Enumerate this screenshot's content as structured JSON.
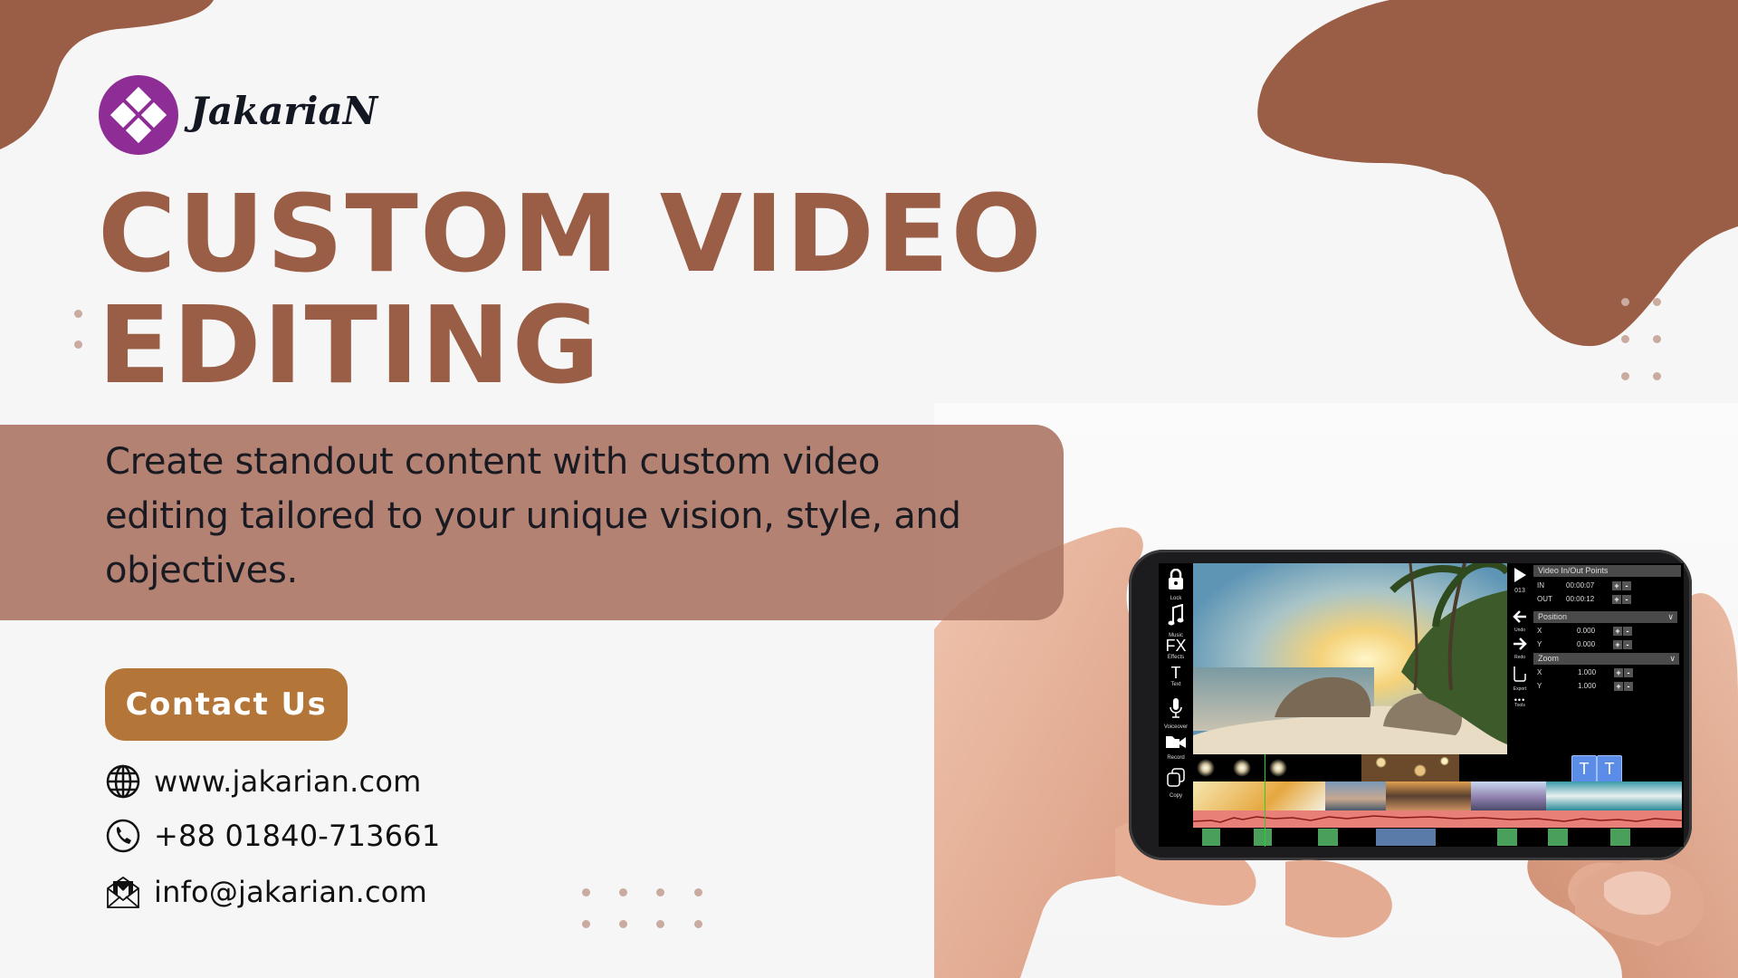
{
  "brand": {
    "name": "JakariaN",
    "logo_color": "#8e2d96"
  },
  "headline": {
    "line1": "CUSTOM VIDEO",
    "line2": "EDITING",
    "color": "#9a5d45"
  },
  "description": "Create standout content with custom video editing tailored to your unique vision, style, and objectives.",
  "cta": {
    "label": "Contact Us",
    "color": "#b47638"
  },
  "contacts": [
    {
      "icon": "globe-icon",
      "text": "www.jakarian.com"
    },
    {
      "icon": "phone-icon",
      "text": "+88 01840-713661"
    },
    {
      "icon": "mail-icon",
      "text": "info@jakarian.com"
    }
  ],
  "colors": {
    "accent_brown": "#9a5d45",
    "band": "#ac7665",
    "background": "#f6f6f6",
    "dots": "#c9aba0"
  },
  "phone_app": {
    "toolbar": [
      {
        "icon": "lock-icon",
        "label": "Lock"
      },
      {
        "icon": "music-icon",
        "label": "Music"
      },
      {
        "icon": "fx-icon",
        "glyph": "FX",
        "label": "Effects"
      },
      {
        "icon": "text-icon",
        "glyph": "T",
        "label": "Text"
      },
      {
        "icon": "microphone-icon",
        "label": "Voiceover"
      },
      {
        "icon": "video-camera-icon",
        "label": "Record"
      },
      {
        "icon": "copy-icon",
        "label": "Copy"
      }
    ],
    "side_actions": [
      {
        "icon": "play-icon",
        "label": "013"
      },
      {
        "icon": "undo-arrow-icon",
        "label": "Undo"
      },
      {
        "icon": "redo-arrow-icon",
        "label": "Redo"
      },
      {
        "icon": "export-icon",
        "label": "Export"
      },
      {
        "icon": "more-dots-icon",
        "label": "Tools"
      }
    ],
    "panel": {
      "inout_title": "Video In/Out Points",
      "in_label": "IN",
      "in_value": "00:00:07",
      "out_label": "OUT",
      "out_value": "00:00:12",
      "position_title": "Position",
      "position_x_label": "X",
      "position_x": "0.000",
      "position_y_label": "Y",
      "position_y": "0.000",
      "zoom_title": "Zoom",
      "zoom_x_label": "X",
      "zoom_x": "1.000",
      "zoom_y_label": "Y",
      "zoom_y": "1.000",
      "plus": "+",
      "minus": "-",
      "chevron": "∨"
    },
    "timeline": {
      "text_clip_glyph": "T"
    }
  }
}
